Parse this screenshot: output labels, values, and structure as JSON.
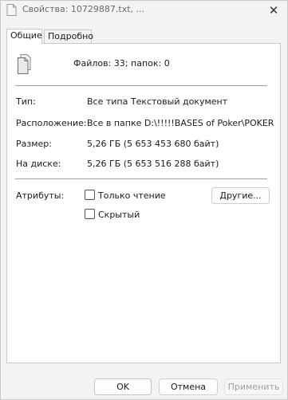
{
  "window": {
    "title": "Свойства: 10729887.txt, ...",
    "close_glyph": "✕"
  },
  "tabs": [
    {
      "label": "Общие",
      "active": true
    },
    {
      "label": "Подробно",
      "active": false
    }
  ],
  "general": {
    "summary": "Файлов: 33; папок: 0",
    "rows": [
      {
        "label": "Тип:",
        "value": "Все типа Текстовый документ"
      },
      {
        "label": "Расположение:",
        "value": "Все в папке D:\\!!!!!BASES of Poker\\POKER"
      },
      {
        "label": "Размер:",
        "value": "5,26 ГБ (5 653 453 680 байт)"
      },
      {
        "label": "На диске:",
        "value": "5,26 ГБ (5 653 516 288 байт)"
      }
    ],
    "attributes": {
      "label": "Атрибуты:",
      "readonly": {
        "label": "Только чтение",
        "checked": false
      },
      "hidden": {
        "label": "Скрытый",
        "checked": false
      },
      "other_button": "Другие..."
    }
  },
  "footer": {
    "ok": "OK",
    "cancel": "Отмена",
    "apply": "Применить",
    "apply_enabled": false
  },
  "colors": {
    "window_bg": "#f3f3f3",
    "panel_bg": "#ffffff",
    "separator": "#a0a0a0",
    "disabled_text": "#a0a0a0"
  }
}
